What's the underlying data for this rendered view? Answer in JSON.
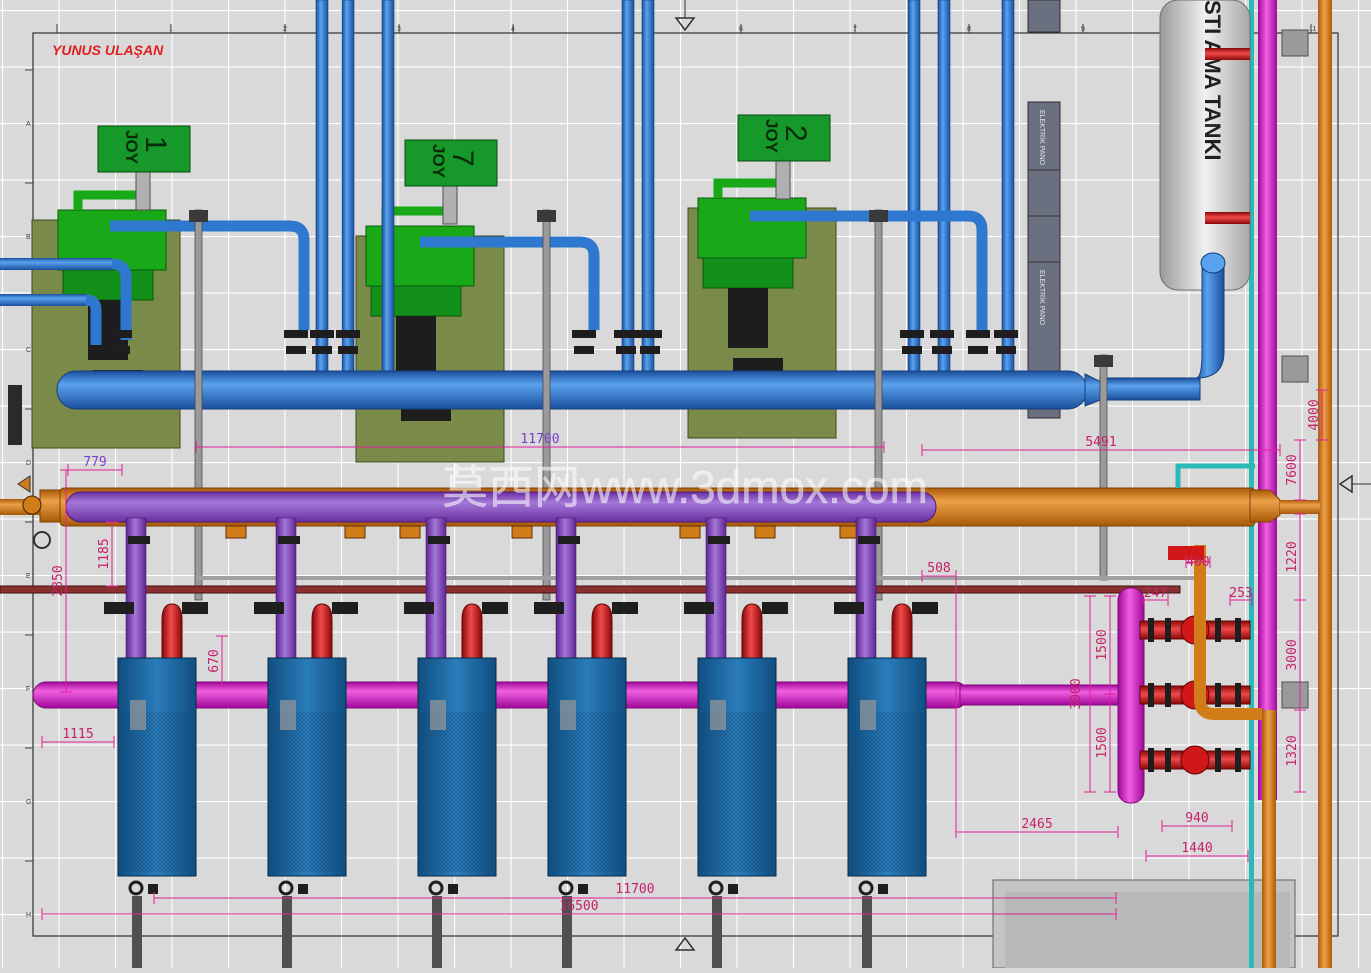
{
  "drawing": {
    "author": "YUNUS ULAŞAN",
    "watermark": "莫西网www.3dmox.com",
    "tank_label": "STI  AMA TANKI",
    "panel_label": "ELEKTRİK PANO",
    "ruler_top": [
      "1",
      "2",
      "3",
      "4",
      "5",
      "6",
      "7",
      "8",
      "9",
      "10",
      "11",
      "12"
    ],
    "ruler_left": [
      "A",
      "B",
      "C",
      "D",
      "E",
      "F",
      "G",
      "H"
    ]
  },
  "chillers": [
    {
      "sign": "1",
      "brand": "JOY"
    },
    {
      "sign": "7",
      "brand": "JOY"
    },
    {
      "sign": "2",
      "brand": "JOY"
    }
  ],
  "dimensions": {
    "d11700_top": "11700",
    "d779": "779",
    "d5491": "5491",
    "d1185": "1185",
    "d2850": "2850",
    "d670": "670",
    "d1115": "1115",
    "d508": "508",
    "d3000a": "3000",
    "d1500a": "1500",
    "d1500b": "1500",
    "d2465": "2465",
    "d11700_bottom": "11700",
    "d16500": "16500",
    "d7600": "7600",
    "d1220": "1220",
    "d3000b": "3000",
    "d1320": "1320",
    "d940": "940",
    "d1440": "1440",
    "d247": "247",
    "d253": "253",
    "d400": "400",
    "d4000": "4000"
  },
  "colors": {
    "background": "#d9d9d9",
    "grid": "#ffffff",
    "chilled_water": "#2f78d0",
    "purple_header": "#8a4fc0",
    "orange_header": "#d07c18",
    "magenta_header": "#e010c8",
    "red_branch": "#d01818",
    "equipment_green": "#18a818",
    "unit_blue": "#1e6ea8",
    "dimension": "#e0209a"
  }
}
